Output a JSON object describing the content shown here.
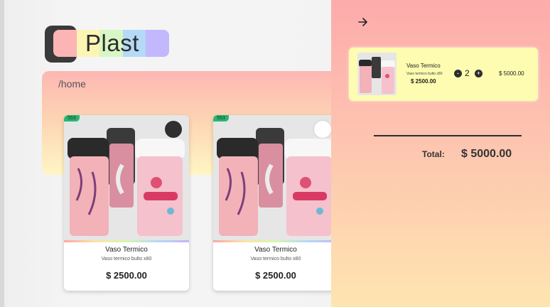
{
  "brand": {
    "name": "Plast",
    "strip_colors": [
      "#fda4a4",
      "#fde3a4",
      "#d8f5b0",
      "#b4d8f5",
      "#c4b4fd"
    ]
  },
  "breadcrumb": "/home",
  "products": [
    {
      "tag": "553",
      "name": "Vaso Termico",
      "description": "Vaso termico bulto x80",
      "price": "$ 2500.00",
      "favorite_style": "dark"
    },
    {
      "tag": "553",
      "name": "Vaso Termico",
      "description": "Vaso termico bulto x80",
      "price": "$ 2500.00",
      "favorite_style": "light"
    }
  ],
  "cart": {
    "back_icon": "arrow-right-icon",
    "items": [
      {
        "name": "Vaso Termico",
        "description": "Vaso termico bulto x80",
        "price": "$ 2500.00",
        "quantity": "2",
        "minus_label": "-",
        "plus_label": "+",
        "line_total": "$ 5000.00"
      }
    ],
    "total_label": "Total:",
    "total_value": "$ 5000.00"
  },
  "colors": {
    "cart_top": "#fdabab",
    "cart_bottom": "#fee5b0",
    "cart_item_bg": "#fdfcb0",
    "tag_green": "#2bb673"
  }
}
